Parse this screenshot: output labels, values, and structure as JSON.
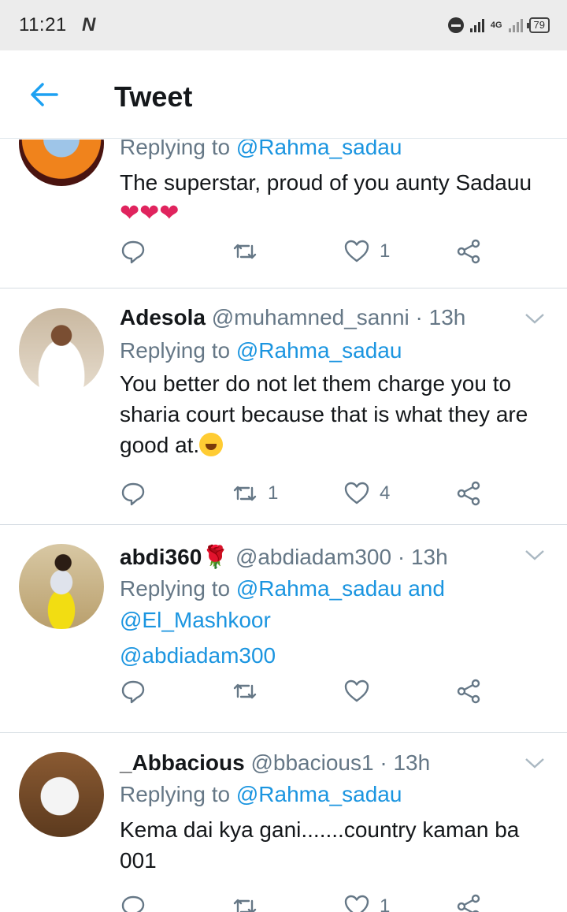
{
  "status_bar": {
    "time": "11:21",
    "carrier_icon": "N",
    "network": "4G",
    "battery": "79"
  },
  "header": {
    "back_icon": "arrow-left-icon",
    "title": "Tweet"
  },
  "colors": {
    "accent": "#1b95e0",
    "secondary_text": "#657786",
    "primary_text": "#14171a",
    "heart_emoji": "#e0245e"
  },
  "tweets": [
    {
      "reply_prefix": "Replying to",
      "reply_to": "@Rahma_sadau",
      "text": "The superstar, proud of you aunty Sadauu",
      "emoji": "❤❤❤",
      "replies": "",
      "retweets": "",
      "likes": "1"
    },
    {
      "name": "Adesola",
      "handle": "@muhamned_sanni",
      "time": "· 13h",
      "reply_prefix": "Replying to",
      "reply_to": "@Rahma_sadau",
      "text": "You better do not let them charge you to sharia court because that is what they are good at.",
      "replies": "",
      "retweets": "1",
      "likes": "4"
    },
    {
      "name": "abdi360",
      "handle": "@abdiadam300",
      "time": "· 13h",
      "reply_prefix": "Replying to",
      "reply_to": "@Rahma_sadau and @El_Mashkoor",
      "text": "@abdiadam300",
      "replies": "",
      "retweets": "",
      "likes": ""
    },
    {
      "name": "_Abbacious",
      "handle": "@bbacious1",
      "time": "· 13h",
      "reply_prefix": "Replying to",
      "reply_to": "@Rahma_sadau",
      "text": "Kema dai kya gani.......country kaman ba 001",
      "replies": "",
      "retweets": "",
      "likes": "1"
    }
  ]
}
